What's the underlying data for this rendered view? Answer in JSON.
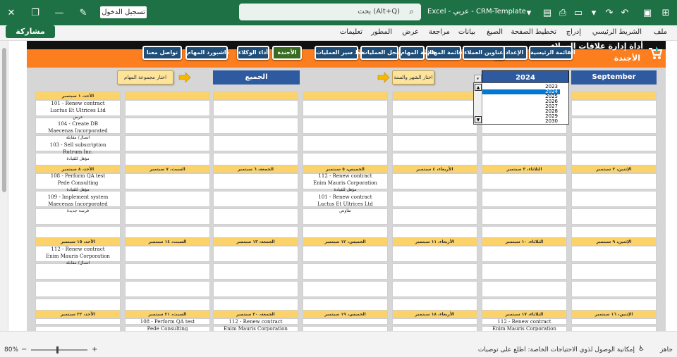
{
  "titlebar": {
    "signin_label": "تسجيل الدخول",
    "search_placeholder": "بحث (Alt+Q)",
    "doc_title": "Excel - عربي - CRM-Template"
  },
  "ribbon": {
    "share_label": "مشاركة",
    "tabs": [
      "ملف",
      "الشريط الرئيسي",
      "إدراج",
      "تخطيط الصفحة",
      "الصيغ",
      "بيانات",
      "مراجعة",
      "عرض",
      "المطور",
      "تعليمات"
    ]
  },
  "app": {
    "title": "أداة إدارة علاقات العملاء",
    "subtitle": "الأجندة",
    "nav": [
      "القائمة الرئيسية",
      "الإعدادات",
      "عناوين العملاء",
      "قائمة المهام",
      "سجل العمليات",
      "خط سير العمليات",
      "الأجندة",
      "أداء الوكلاء",
      "داشبورد المهام",
      "تواصل معنا"
    ]
  },
  "controls": {
    "month": "September",
    "year": "2024",
    "month_hint": "اختار الشهر والسنة",
    "group": "الجميع",
    "group_hint": "اختار مجموعة المهام",
    "years": [
      "2023",
      "2024",
      "2025",
      "2026",
      "2027",
      "2028",
      "2029",
      "2030"
    ],
    "selected_year_index": 1
  },
  "week1": {
    "empty": "",
    "sun_header": "الأحد، ١ سبتمبر",
    "sun_events": [
      {
        "title": "101 - Renew contract",
        "company": "Luctus Et Ultrices Ltd",
        "status": "عرض"
      },
      {
        "title": "104 - Create DB",
        "company": "Maecenas Incorporated",
        "status": "اتصال/ مقابلة"
      },
      {
        "title": "103 - Sell subscription",
        "company": "Rutrum Inc.",
        "status": "مؤهل للقيادة"
      }
    ]
  },
  "week2": {
    "headers": [
      "الأحد، ٨ سبتمبر",
      "السبت، ٧ سبتمبر",
      "الجمعة، ٦ سبتمبر",
      "الخميس، ٥ سبتمبر",
      "الأربعاء، ٤ سبتمبر",
      "الثلاثاء، ٣ سبتمبر",
      "الإثنين، ٢ سبتمبر"
    ],
    "sun_events": [
      {
        "title": "108 - Perform QA test",
        "company": "Pede Consulting",
        "status": "مؤهل للقيادة"
      },
      {
        "title": "109 - Implement system",
        "company": "Maecenas Incorporated",
        "status": "فرصة جديدة"
      }
    ],
    "thu_events": [
      {
        "title": "112 - Renew contract",
        "company": "Enim Mauris Corporation",
        "status": "مؤهل للقيادة"
      },
      {
        "title": "101 - Renew contract",
        "company": "Luctus Et Ultrices Ltd",
        "status": "تفاوض"
      }
    ]
  },
  "week3": {
    "headers": [
      "الأحد، ١٥ سبتمبر",
      "السبت، ١٤ سبتمبر",
      "الجمعة، ١٣ سبتمبر",
      "الخميس، ١٢ سبتمبر",
      "الأربعاء، ١١ سبتمبر",
      "الثلاثاء، ١٠ سبتمبر",
      "الإثنين، ٩ سبتمبر"
    ],
    "sun_events": [
      {
        "title": "112 - Renew contract",
        "company": "Enim Mauris Corporation",
        "status": "اتصال/ مقابلة"
      }
    ]
  },
  "week4": {
    "headers": [
      "الأحد، ٢٢ سبتمبر",
      "السبت، ٢١ سبتمبر",
      "الجمعة، ٢٠ سبتمبر",
      "الخميس، ١٩ سبتمبر",
      "الأربعاء، ١٨ سبتمبر",
      "الثلاثاء، ١٧ سبتمبر",
      "الإثنين، ١٦ سبتمبر"
    ],
    "sat_event": {
      "title": "108 - Perform QA test",
      "company": "Pede Consulting"
    },
    "fri_event": {
      "title": "112 - Renew contract",
      "company": "Enim Mauris Corporation"
    },
    "tue_event": {
      "title": "112 - Renew contract",
      "company": "Enim Mauris Corporation"
    }
  },
  "status": {
    "zoom": "80%",
    "ready": "جاهز",
    "accessibility": "إمكانية الوصول لذوي الاحتياجات الخاصة: اطلع على توصيات"
  },
  "colors": {
    "excel_green": "#1e7145",
    "banner_orange": "#fd7e1e",
    "nav_blue": "#1f4e79",
    "header_yellow": "#fcd36b"
  }
}
